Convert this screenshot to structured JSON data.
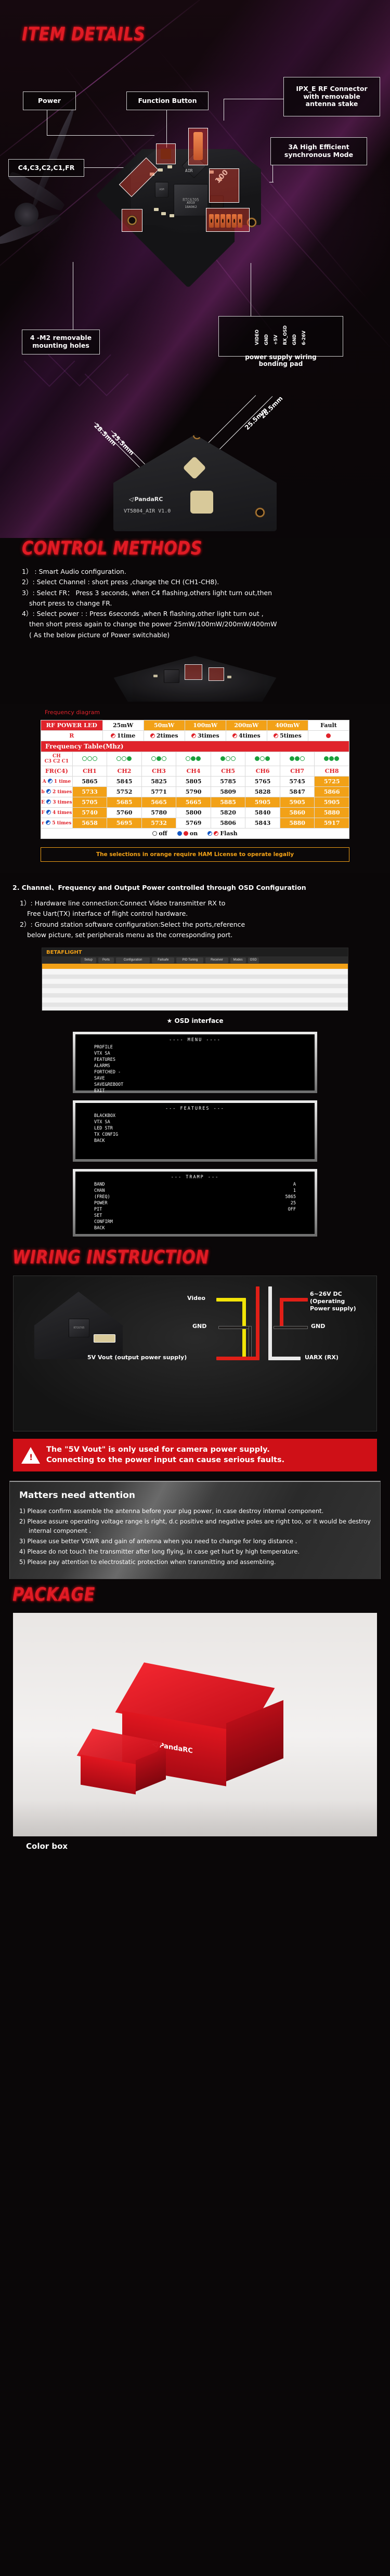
{
  "sections": {
    "item_details": {
      "title": "ITEM DETAILS"
    },
    "control_methods": {
      "title": "CONTROL METHODS"
    },
    "wiring": {
      "title": "WIRING INSTRUCTION"
    },
    "package": {
      "title": "PACKAGE"
    }
  },
  "callouts": {
    "power": "Power",
    "function_button": "Function Button",
    "ipx": "IPX_E RF Connector\nwith removable\nantenna stake",
    "channels": "C4,C3,C2,C1,FR",
    "mode_3a": "3A High Efficient\nsynchronous Mode",
    "mounting": "4 -M2 removable\nmounting holes",
    "pads": "VIDEO  GND  +5V  RX_OSD  GND  6-26V\npower supply wiring\nbonding pad",
    "pad_pins": [
      "VIDEO",
      "GND",
      "+5V",
      "RX_OSD",
      "GND",
      "6-26V"
    ]
  },
  "board": {
    "silk_brand": "PandaRC",
    "silk_model": "VT5804_AIR  V1.0",
    "chip_main": "RTC6705",
    "chip_main_l2": "A919",
    "chip_main_l3": "18A962",
    "silk_air": "AIR",
    "silk_100": "100",
    "pin_silk": [
      "Video",
      "GND",
      "+5V",
      "RX",
      "GND",
      "Vin"
    ]
  },
  "dimensions": {
    "d1": "28.5mm",
    "d2": "25.5mm",
    "d3": "28.5mm",
    "d4": "25.5mm"
  },
  "control_methods": {
    "items": [
      "1） : Smart Audio configuration.",
      "2）: Select Channel :   short press ,change the CH (CH1-CH8).",
      "3）: Select FR：  Press 3 seconds, when C4 flashing,others light turn out,then",
      "short press to change FR.",
      "4）: Select power : : Press 6seconds ,when R flashing,other light turn out ,",
      "then short press again to change the power 25mW/100mW/200mW/400mW",
      "( As the below picture of Power switchable)"
    ]
  },
  "frequency": {
    "diagram_label": "Frequency diagram",
    "power_led": {
      "header_label": "RF POWER LED",
      "levels": [
        "25mW",
        "50mW",
        "100mW",
        "200mW",
        "400mW",
        "Fault"
      ],
      "row_label": "R",
      "flashes": [
        "1time",
        "2times",
        "3times",
        "4times",
        "5times"
      ],
      "fault_indicator": "solid"
    },
    "table_title": "Frequency  Table(Mhz)",
    "ch_header_label": "CH",
    "ch_header_sub": "C3 C2 C1",
    "fr_label": "FR(C4)",
    "channels": [
      "CH1",
      "CH2",
      "CH3",
      "CH4",
      "CH5",
      "CH6",
      "CH7",
      "CH8"
    ],
    "led_patterns": [
      [
        0,
        0,
        0
      ],
      [
        0,
        0,
        1
      ],
      [
        0,
        1,
        0
      ],
      [
        0,
        1,
        1
      ],
      [
        1,
        0,
        0
      ],
      [
        1,
        0,
        1
      ],
      [
        1,
        1,
        0
      ],
      [
        1,
        1,
        1
      ]
    ],
    "bands": [
      {
        "name": "A",
        "flash": "1 time",
        "values": [
          5865,
          5845,
          5825,
          5805,
          5785,
          5765,
          5745,
          5725
        ],
        "hl": [
          0,
          0,
          0,
          0,
          0,
          0,
          0,
          1
        ]
      },
      {
        "name": "b",
        "flash": "2 times",
        "values": [
          5733,
          5752,
          5771,
          5790,
          5809,
          5828,
          5847,
          5866
        ],
        "hl": [
          1,
          0,
          0,
          0,
          0,
          0,
          0,
          1
        ]
      },
      {
        "name": "E",
        "flash": "3 times",
        "values": [
          5705,
          5685,
          5665,
          5665,
          5885,
          5905,
          5905,
          5905
        ],
        "hl": [
          1,
          1,
          1,
          1,
          1,
          1,
          1,
          1
        ]
      },
      {
        "name": "F",
        "flash": "4 times",
        "values": [
          5740,
          5760,
          5780,
          5800,
          5820,
          5840,
          5860,
          5880
        ],
        "hl": [
          1,
          0,
          0,
          0,
          0,
          0,
          1,
          1
        ]
      },
      {
        "name": "r",
        "flash": "5 times",
        "values": [
          5658,
          5695,
          5732,
          5769,
          5806,
          5843,
          5880,
          5917
        ],
        "hl": [
          1,
          1,
          1,
          0,
          0,
          0,
          1,
          1
        ]
      }
    ],
    "legend": {
      "off": "off",
      "on": "on",
      "flash": "Flash"
    },
    "ham_note": "The selections in orange require HAM License to operate legally"
  },
  "osd": {
    "heading": "2. Channel、Frequency and Output Power controlled through OSD Configuration",
    "step1": "1）: Hardware line connection:Connect Video transmitter RX to",
    "step1b": "Free Uart(TX) interface of flight control hardware.",
    "step2": "2）: Ground station software configuration:Select the ports,reference",
    "step2b": "below picture, set peripherals menu as the corresponding port.",
    "bf_logo": "BETAFLIGHT",
    "bf_tabs": [
      "Setup",
      "Ports",
      "Configuration",
      "Failsafe",
      "PID Tuning",
      "Receiver",
      "Modes",
      "OSD"
    ],
    "osd_caption": "★ OSD interface",
    "panels": [
      {
        "title": "---- MENU ----",
        "rows": [
          "PROFILE",
          "VTX SA",
          "FEATURES",
          "ALARMS",
          "FORTCHED -",
          "SAVE",
          "SAVE&REBOOT",
          "EXIT"
        ]
      },
      {
        "title": "--- FEATURES ---",
        "rows": [
          "BLACKBOX",
          "VTX SA",
          "LED STR",
          "TX CONFIG",
          "BACK"
        ]
      },
      {
        "title": "--- TRAMP ---",
        "rows": [
          {
            "k": "BAND",
            "v": "A"
          },
          {
            "k": "CHAN",
            "v": "1"
          },
          {
            "k": "(FREQ)",
            "v": "5865"
          },
          {
            "k": "POWER",
            "v": "25"
          },
          {
            "k": "PIT",
            "v": "OFF"
          },
          {
            "k": "SET",
            "v": ""
          },
          {
            "k": "CONFIRM",
            "v": ""
          },
          {
            "k": "BACK",
            "v": ""
          }
        ]
      }
    ]
  },
  "wiring": {
    "labels": {
      "video": "Video",
      "gnd_left": "GND",
      "vout": "5V Vout (output power supply)",
      "dc": "6~26V DC (Operating\nPower supply)",
      "gnd_right": "GND",
      "uarx": "UARX (RX)"
    },
    "warning_line1": "The \"5V Vout\" is only used for camera power supply.",
    "warning_line2": "Connecting to the power input can cause serious faults."
  },
  "attention": {
    "title": "Matters need attention",
    "items": [
      "1) Please confirm assemble the antenna before your plug power, in case destroy internal component.",
      "2) Please assure operating voltage range is right, d.c positive and negative poles are right too, or it would be destroy internal component .",
      "3) Please use better VSWR and gain of antenna when you need to change for long distance .",
      "4) Please do not touch the transmitter after long flying, in case get hurt by high temperature.",
      "5) Please pay attention to electrostatic protection when transmitting and assembling."
    ]
  },
  "package": {
    "brand": "PandaRC",
    "caption": "Color box"
  }
}
